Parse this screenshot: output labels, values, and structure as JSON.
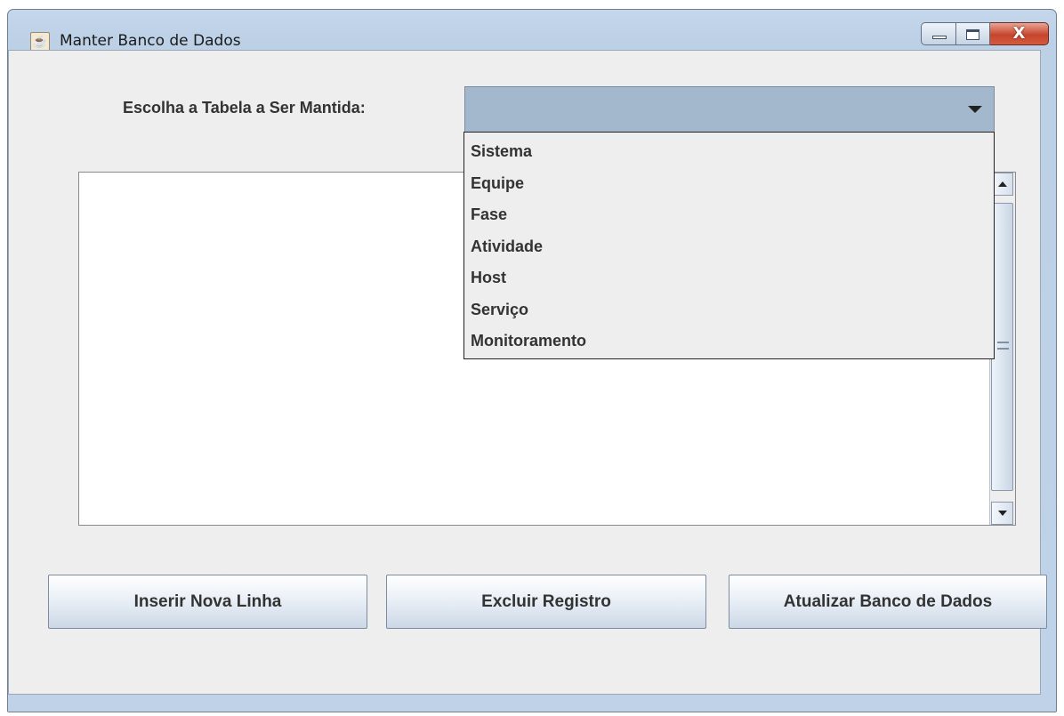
{
  "window": {
    "title": "Manter Banco de Dados",
    "controls": [
      "minimize-icon",
      "maximize-icon",
      "close-icon"
    ],
    "close_glyph": "X"
  },
  "form": {
    "choose_label": "Escolha a Tabela a Ser Mantida:",
    "table_selected": ""
  },
  "dropdown": {
    "options": [
      "Sistema",
      "Equipe",
      "Fase",
      "Atividade",
      "Host",
      "Serviço",
      "Monitoramento"
    ]
  },
  "buttons": {
    "insert_label": "Inserir Nova Linha",
    "delete_label": "Excluir Registro",
    "update_label": "Atualizar Banco de Dados"
  },
  "colors": {
    "combo_background": "#a3b8cc",
    "panel_background": "#eeeeee",
    "close_button": "#c6452c"
  }
}
